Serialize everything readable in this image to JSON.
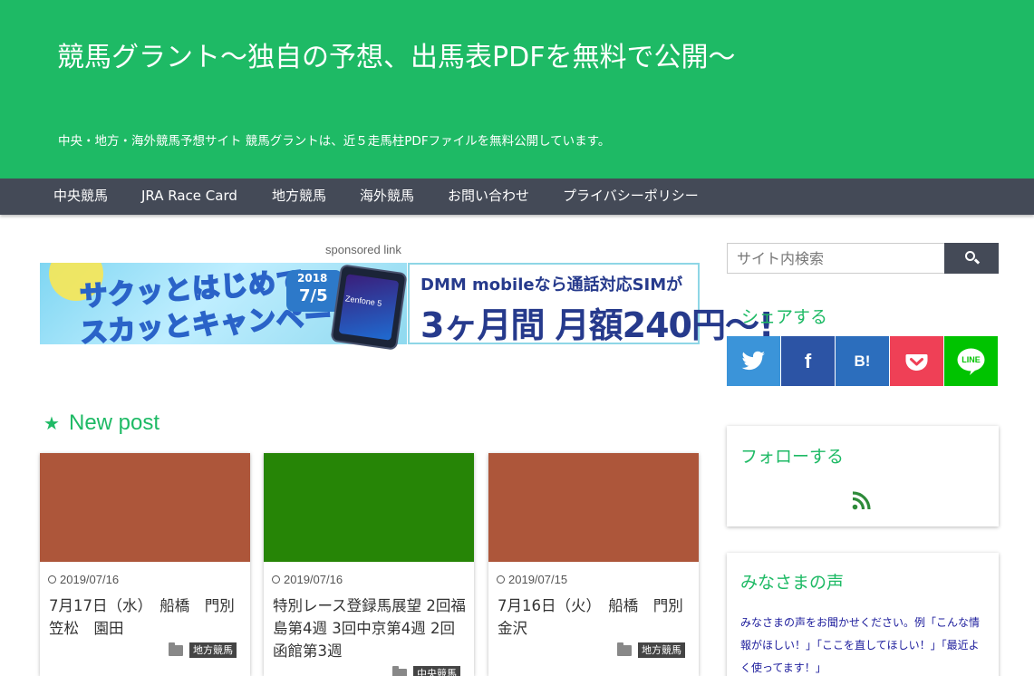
{
  "header": {
    "title": "競馬グラント〜独自の予想、出馬表PDFを無料で公開〜",
    "description": "中央・地方・海外競馬予想サイト 競馬グラントは、近５走馬柱PDFファイルを無料公開しています。"
  },
  "nav": {
    "items": [
      {
        "label": "中央競馬"
      },
      {
        "label": "JRA Race Card"
      },
      {
        "label": "地方競馬"
      },
      {
        "label": "海外競馬"
      },
      {
        "label": "お問い合わせ"
      },
      {
        "label": "プライバシーポリシー"
      }
    ]
  },
  "ad": {
    "sponsored_label": "sponsored link",
    "campaign_line1": "サクッとはじめて",
    "campaign_line2": "スカッとキャンペーン",
    "year": "2018",
    "date": "7/5",
    "phone_brand": "Zenfone 5",
    "right_line1": "DMM mobileなら通話対応SIMが",
    "right_line2": "3ヶ月間 月額240円〜!"
  },
  "main": {
    "section_title": "New post",
    "posts": [
      {
        "date": "2019/07/16",
        "title": "7月17日（水）　船橋　門別　笠松　園田",
        "category": "地方競馬",
        "thumb_color": "#ad563a"
      },
      {
        "date": "2019/07/16",
        "title": "特別レース登録馬展望 2回福島第4週 3回中京第4週 2回函館第3週",
        "category": "中央競馬",
        "thumb_color": "#268506"
      },
      {
        "date": "2019/07/15",
        "title": "7月16日（火）　船橋　門別　金沢",
        "category": "地方競馬",
        "thumb_color": "#ad563a"
      }
    ]
  },
  "sidebar": {
    "search_placeholder": "サイト内検索",
    "share_title": "シェアする",
    "share_buttons": [
      {
        "icon": "twitter-icon",
        "color": "#3b94d9"
      },
      {
        "icon": "facebook-icon",
        "color": "#2c54a5",
        "glyph": "f"
      },
      {
        "icon": "hatena-bookmark-icon",
        "color": "#2c6ebd",
        "glyph": "B!"
      },
      {
        "icon": "pocket-icon",
        "color": "#ef4056"
      },
      {
        "icon": "line-icon",
        "color": "#00c300",
        "glyph": "LINE"
      }
    ],
    "follow_title": "フォローする",
    "voice_title": "みなさまの声",
    "voice_text": "みなさまの声をお聞かせください。例「こんな情報がほしい！」「ここを直してほしい！」「最近よく使ってます！」"
  }
}
